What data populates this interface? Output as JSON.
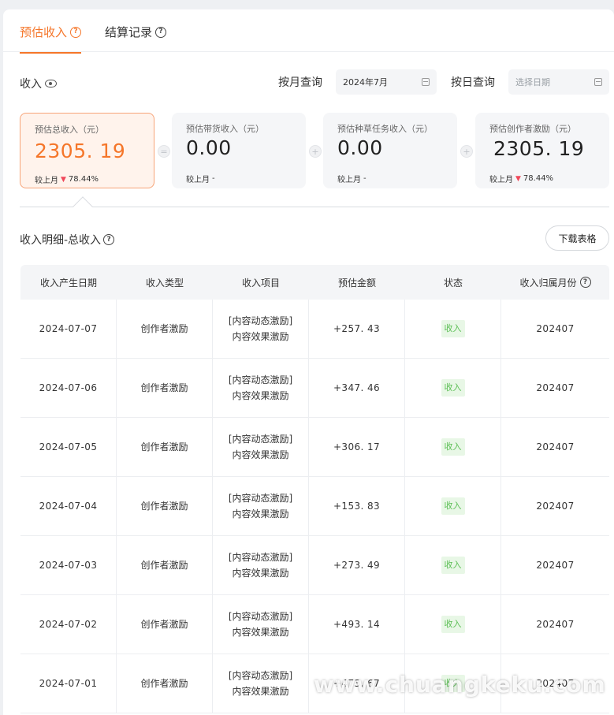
{
  "tabs": [
    {
      "label": "预估收入",
      "active": true
    },
    {
      "label": "结算记录",
      "active": false
    }
  ],
  "income": {
    "label": "收入",
    "month_filter_label": "按月查询",
    "month_value": "2024年7月",
    "day_filter_label": "按日查询",
    "day_placeholder": "选择日期"
  },
  "cards": [
    {
      "title": "预估总收入（元）",
      "value": "2305. 19",
      "compare_label": "较上月",
      "compare_value": "78.44%",
      "trend": "down"
    },
    {
      "title": "预估带货收入（元）",
      "value": "0.00",
      "compare_label": "较上月",
      "compare_value": "-"
    },
    {
      "title": "预估种草任务收入（元）",
      "value": "0.00",
      "compare_label": "较上月",
      "compare_value": "-"
    },
    {
      "title": "预估创作者激励（元）",
      "value": "2305. 19",
      "compare_label": "较上月",
      "compare_value": "78.44%",
      "trend": "down"
    }
  ],
  "operators": [
    "=",
    "+",
    "+"
  ],
  "detail": {
    "title": "收入明细-总收入",
    "download_label": "下载表格"
  },
  "table": {
    "headers": [
      "收入产生日期",
      "收入类型",
      "收入项目",
      "预估金额",
      "状态",
      "收入归属月份"
    ],
    "rows": [
      {
        "date": "2024-07-07",
        "type": "创作者激励",
        "item1": "[内容动态激励]",
        "item2": "内容效果激励",
        "amount": "+257. 43",
        "status": "收入",
        "month": "202407"
      },
      {
        "date": "2024-07-06",
        "type": "创作者激励",
        "item1": "[内容动态激励]",
        "item2": "内容效果激励",
        "amount": "+347. 46",
        "status": "收入",
        "month": "202407"
      },
      {
        "date": "2024-07-05",
        "type": "创作者激励",
        "item1": "[内容动态激励]",
        "item2": "内容效果激励",
        "amount": "+306. 17",
        "status": "收入",
        "month": "202407"
      },
      {
        "date": "2024-07-04",
        "type": "创作者激励",
        "item1": "[内容动态激励]",
        "item2": "内容效果激励",
        "amount": "+153. 83",
        "status": "收入",
        "month": "202407"
      },
      {
        "date": "2024-07-03",
        "type": "创作者激励",
        "item1": "[内容动态激励]",
        "item2": "内容效果激励",
        "amount": "+273. 49",
        "status": "收入",
        "month": "202407"
      },
      {
        "date": "2024-07-02",
        "type": "创作者激励",
        "item1": "[内容动态激励]",
        "item2": "内容效果激励",
        "amount": "+493. 14",
        "status": "收入",
        "month": "202407"
      },
      {
        "date": "2024-07-01",
        "type": "创作者激励",
        "item1": "[内容动态激励]",
        "item2": "内容效果激励",
        "amount": "+473. 67",
        "status": "收入",
        "month": "202407"
      }
    ]
  },
  "watermark": "www.chuangkeku.com",
  "colors": {
    "accent": "#f5762a",
    "status_green": "#5cbf55",
    "trend_down": "#f0485a"
  }
}
